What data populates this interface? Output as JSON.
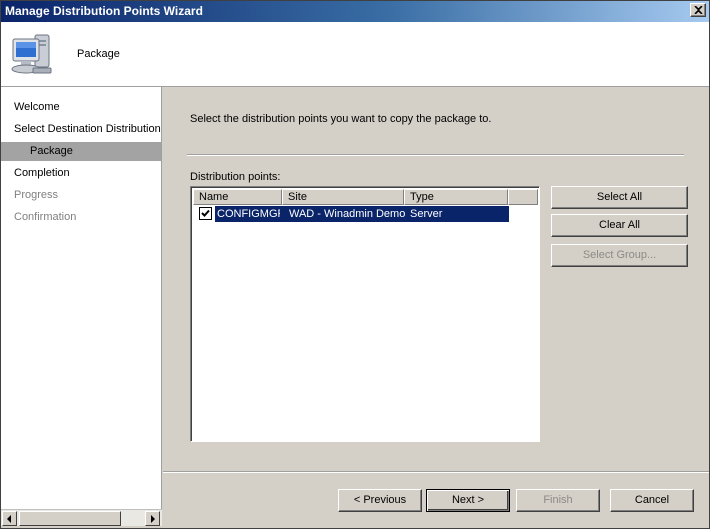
{
  "window": {
    "title": "Manage Distribution Points Wizard"
  },
  "header": {
    "title": "Package",
    "icon": "computer-icon"
  },
  "sidebar": {
    "items": [
      {
        "label": "Welcome",
        "state": "normal"
      },
      {
        "label": "Select Destination Distribution Points",
        "state": "normal"
      },
      {
        "label": "Package",
        "state": "selected"
      },
      {
        "label": "Completion",
        "state": "normal"
      },
      {
        "label": "Progress",
        "state": "disabled"
      },
      {
        "label": "Confirmation",
        "state": "disabled"
      }
    ]
  },
  "main": {
    "instruction": "Select the distribution points you want to copy the package to.",
    "list_label": "Distribution points:",
    "columns": [
      "Name",
      "Site",
      "Type"
    ],
    "rows": [
      {
        "checked": true,
        "name": "CONFIGMGR",
        "site": "WAD - Winadmin Demo",
        "type": "Server"
      }
    ],
    "buttons": {
      "select_all": "Select All",
      "clear_all": "Clear All",
      "select_group": "Select Group..."
    }
  },
  "footer": {
    "previous": "< Previous",
    "next": "Next >",
    "finish": "Finish",
    "cancel": "Cancel"
  },
  "colors": {
    "selection": "#0a246a",
    "titlebar_start": "#0a246a",
    "panel": "#d4d0c8"
  }
}
